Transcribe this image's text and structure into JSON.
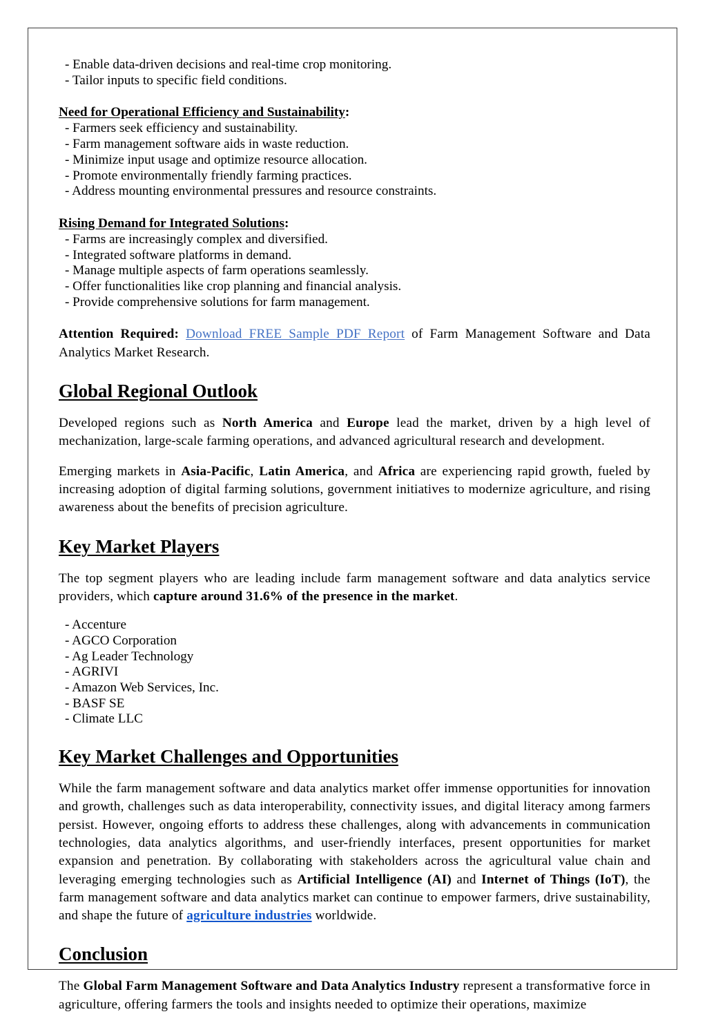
{
  "document": {
    "page_border_color": "#3c3c3c",
    "body_text_color": "#000000"
  },
  "colors": {
    "link_plain": "#4472c4",
    "link_bold": "#1155cc"
  },
  "blocks": {
    "top_bullets": [
      "- Enable data-driven decisions and real-time crop monitoring.",
      "- Tailor inputs to specific field conditions."
    ],
    "efficiency": {
      "heading_underlined": "Need for Operational Efficiency and Sustainability",
      "heading_tail": ":",
      "bullets": [
        "- Farmers seek efficiency and sustainability.",
        "- Farm management software aids in waste reduction.",
        "- Minimize input usage and optimize resource allocation.",
        "- Promote environmentally friendly farming practices.",
        "- Address mounting environmental pressures and resource constraints."
      ]
    },
    "integrated": {
      "heading_underlined": "Rising Demand for Integrated Solutions",
      "heading_tail": ":",
      "bullets": [
        "- Farms are increasingly complex and diversified.",
        "- Integrated software platforms in demand.",
        "- Manage multiple aspects of farm operations seamlessly.",
        "- Offer functionalities like crop planning and financial analysis.",
        "- Provide comprehensive solutions for farm management."
      ]
    },
    "attention": {
      "label": "Attention Required:",
      "link_text": "Download FREE Sample PDF Report",
      "rest": " of Farm Management Software and Data Analytics Market Research."
    },
    "regional": {
      "heading": "Global Regional Outlook",
      "p1_a": "Developed regions such as ",
      "p1_b1": "North America",
      "p1_c": " and ",
      "p1_b2": "Europe",
      "p1_d": " lead the market, driven by a high level of mechanization, large-scale farming operations, and advanced agricultural research and development.",
      "p2_a": "Emerging markets in ",
      "p2_b1": "Asia-Pacific",
      "p2_c": ", ",
      "p2_b2": "Latin America",
      "p2_d": ", and ",
      "p2_b3": "Africa",
      "p2_e": " are experiencing rapid growth, fueled by increasing adoption of digital farming solutions, government initiatives to modernize agriculture, and rising awareness about the benefits of precision agriculture."
    },
    "players": {
      "heading": "Key Market Players",
      "intro_a": "The top segment players who are leading include farm management software and data analytics service providers, which ",
      "intro_b": "capture around 31.6% of the presence in the market",
      "intro_c": ".",
      "list": [
        "- Accenture",
        "- AGCO Corporation",
        "- Ag Leader Technology",
        "- AGRIVI",
        "- Amazon Web Services, Inc.",
        "- BASF SE",
        "- Climate LLC"
      ]
    },
    "challenges": {
      "heading": "Key Market Challenges and Opportunities",
      "p_a": "While the farm management software and data analytics market offer immense opportunities for innovation and growth, challenges such as data interoperability, connectivity issues, and digital literacy among farmers persist. However, ongoing efforts to address these challenges, along with advancements in communication technologies, data analytics algorithms, and user-friendly interfaces, present opportunities for market expansion and penetration. By collaborating with stakeholders across the agricultural value chain and leveraging emerging technologies such as ",
      "p_b1": "Artificial Intelligence (AI)",
      "p_c": " and ",
      "p_b2": "Internet of Things (IoT)",
      "p_d": ", the farm management software and data analytics market can continue to empower farmers, drive sustainability, and shape the future of ",
      "p_link": "agriculture industries",
      "p_e": " worldwide."
    },
    "conclusion": {
      "heading": "Conclusion",
      "p_a": "The ",
      "p_b": "Global Farm Management Software and Data Analytics Industry",
      "p_c": " represent a transformative force in agriculture, offering farmers the tools and insights needed to optimize their operations, maximize"
    }
  }
}
